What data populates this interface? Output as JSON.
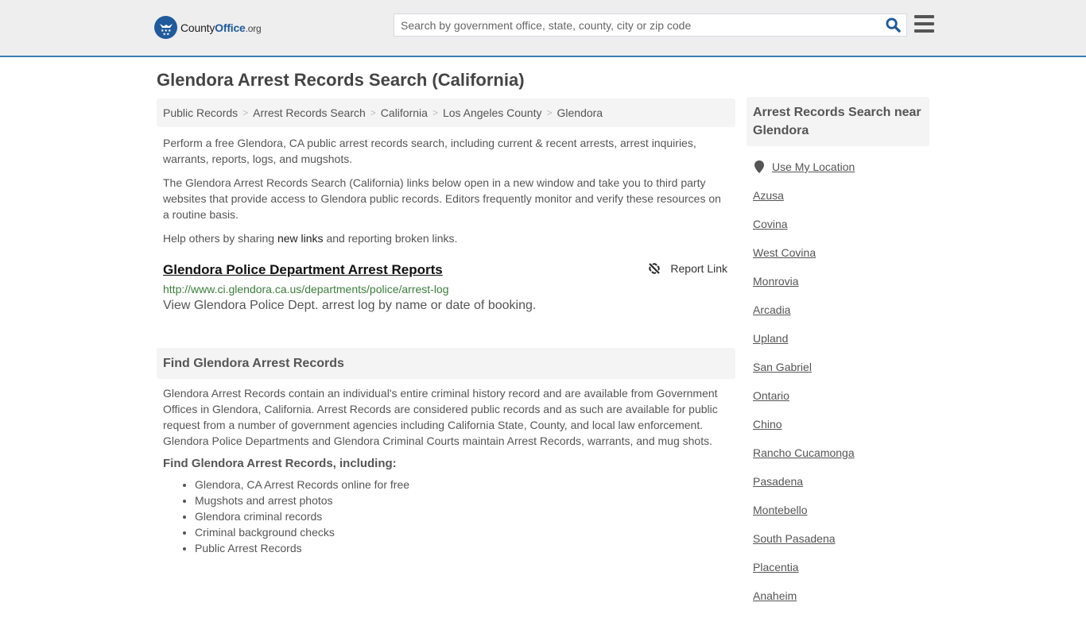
{
  "header": {
    "logo": {
      "county": "County",
      "office": "Office",
      "tld": ".org"
    },
    "search_placeholder": "Search by government office, state, county, city or zip code",
    "search_icon": "search-icon",
    "menu_icon": "hamburger-menu-icon"
  },
  "page": {
    "title": "Glendora Arrest Records Search (California)"
  },
  "breadcrumb": [
    "Public Records",
    "Arrest Records Search",
    "California",
    "Los Angeles County",
    "Glendora"
  ],
  "intro": {
    "p1": "Perform a free Glendora, CA public arrest records search, including current & recent arrests, arrest inquiries, warrants, reports, logs, and mugshots.",
    "p2": "The Glendora Arrest Records Search (California) links below open in a new window and take you to third party websites that provide access to Glendora public records. Editors frequently monitor and verify these resources on a routine basis.",
    "p3_before": "Help others by sharing ",
    "p3_link": "new links",
    "p3_after": " and reporting broken links."
  },
  "resource": {
    "title": "Glendora Police Department Arrest Reports",
    "url": "http://www.ci.glendora.ca.us/departments/police/arrest-log",
    "description": "View Glendora Police Dept. arrest log by name or date of booking.",
    "report_label": "Report Link",
    "report_icon": "broken-link-icon"
  },
  "find_section": {
    "heading": "Find Glendora Arrest Records",
    "body": "Glendora Arrest Records contain an individual's entire criminal history record and are available from Government Offices in Glendora, California. Arrest Records are considered public records and as such are available for public request from a number of government agencies including California State, County, and local law enforcement. Glendora Police Departments and Glendora Criminal Courts maintain Arrest Records, warrants, and mug shots.",
    "subheading": "Find Glendora Arrest Records, including:",
    "bullets": [
      "Glendora, CA Arrest Records online for free",
      "Mugshots and arrest photos",
      "Glendora criminal records",
      "Criminal background checks",
      "Public Arrest Records"
    ]
  },
  "sidebar": {
    "heading": "Arrest Records Search near Glendora",
    "use_location": "Use My Location",
    "location_icon": "map-pin-icon",
    "cities": [
      "Azusa",
      "Covina",
      "West Covina",
      "Monrovia",
      "Arcadia",
      "Upland",
      "San Gabriel",
      "Ontario",
      "Chino",
      "Rancho Cucamonga",
      "Pasadena",
      "Montebello",
      "South Pasadena",
      "Placentia",
      "Anaheim"
    ]
  },
  "colors": {
    "brand_blue": "#1f5a9c",
    "header_border": "#3c7db0",
    "url_green": "#3a7d3a",
    "panel_gray": "#f4f4f4"
  }
}
